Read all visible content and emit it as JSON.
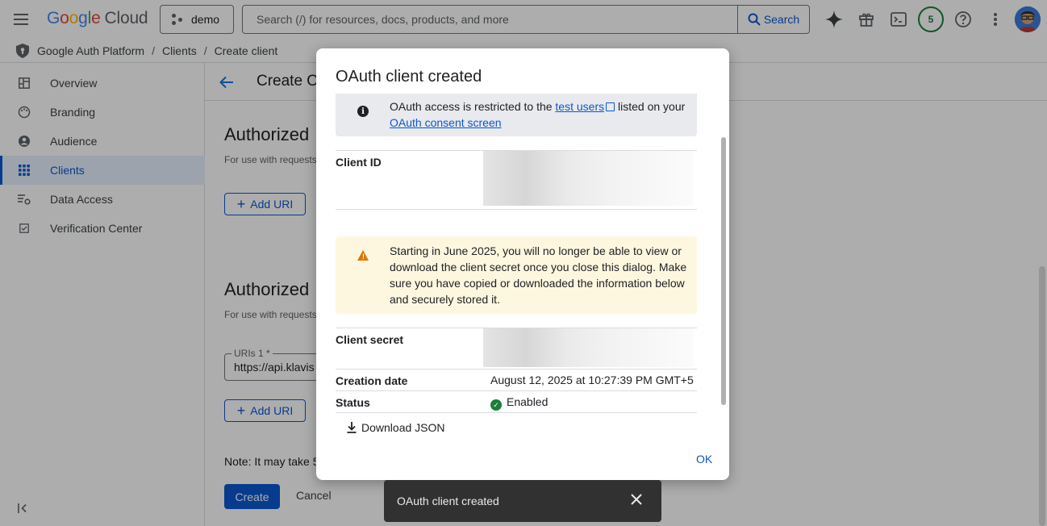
{
  "header": {
    "logo_google": [
      "G",
      "o",
      "o",
      "g",
      "l",
      "e"
    ],
    "logo_cloud": "Cloud",
    "project": "demo",
    "search_placeholder": "Search (/) for resources, docs, products, and more",
    "search_button": "Search",
    "notifications_count": "5"
  },
  "breadcrumb": {
    "items": [
      "Google Auth Platform",
      "Clients",
      "Create client"
    ],
    "separator": "/"
  },
  "sidebar": {
    "items": [
      {
        "label": "Overview",
        "icon": "dashboard-icon"
      },
      {
        "label": "Branding",
        "icon": "palette-icon"
      },
      {
        "label": "Audience",
        "icon": "person-icon"
      },
      {
        "label": "Clients",
        "icon": "grid-icon"
      },
      {
        "label": "Data Access",
        "icon": "data-access-icon"
      },
      {
        "label": "Verification Center",
        "icon": "verification-icon"
      }
    ],
    "active": "Clients"
  },
  "main": {
    "title": "Create O",
    "section1_title": "Authorized",
    "section1_sub": "For use with requests",
    "add_uri_label": "Add URI",
    "section2_title": "Authorized",
    "section2_sub": "For use with requests",
    "uri_field_label": "URIs 1 *",
    "uri_field_value": "https://api.klavis",
    "note": "Note: It may take 5",
    "create_label": "Create",
    "cancel_label": "Cancel"
  },
  "dialog": {
    "title": "OAuth client created",
    "info_text_1": "OAuth access is restricted to the ",
    "info_link_1": "test users",
    "info_text_2": " listed on your ",
    "info_link_2": "OAuth consent screen",
    "client_id_label": "Client ID",
    "warning_text": "Starting in June 2025, you will no longer be able to view or download the client secret once you close this dialog. Make sure you have copied or downloaded the information below and securely stored it.",
    "client_secret_label": "Client secret",
    "creation_date_label": "Creation date",
    "creation_date_value": "August 12, 2025 at 10:27:39 PM GMT+5",
    "status_label": "Status",
    "status_value": "Enabled",
    "download_label": "Download JSON",
    "ok_label": "OK"
  },
  "snackbar": {
    "message": "OAuth client created"
  },
  "colors": {
    "accent": "#0b57d0",
    "warning_bg": "#fef7e0",
    "warning_icon": "#e37400",
    "info_bg": "#e8eaed",
    "success": "#188038"
  }
}
